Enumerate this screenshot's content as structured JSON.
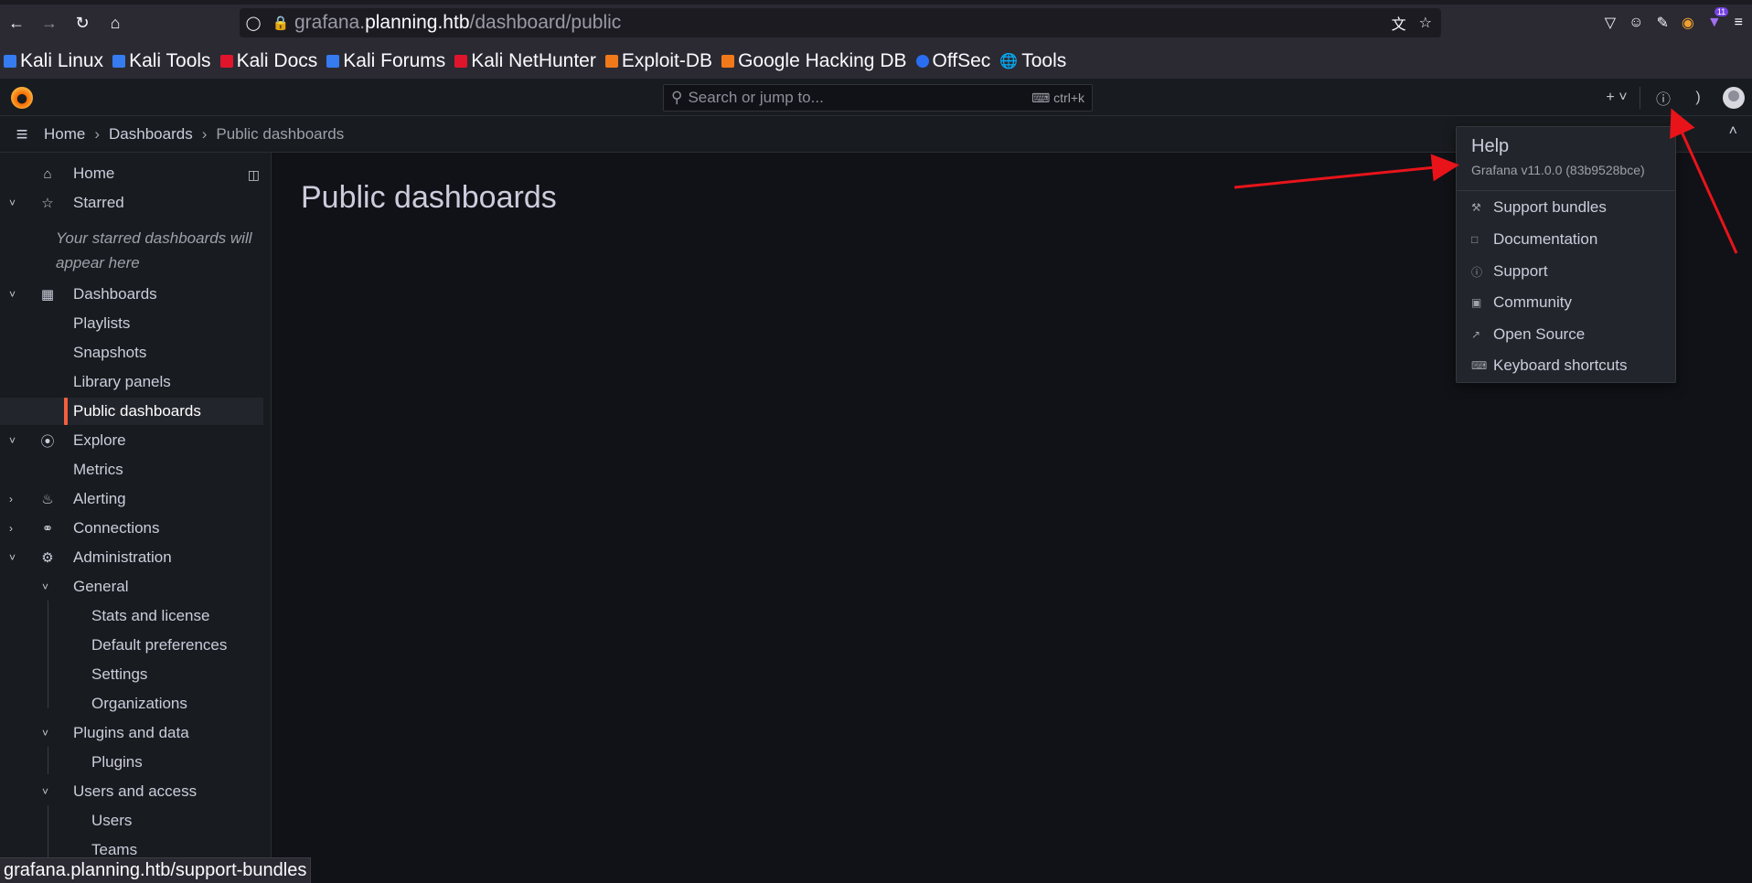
{
  "browser": {
    "url_host_prefix": "grafana.",
    "url_host_main": "planning.htb",
    "url_path": "/dashboard/public",
    "nav_icons": [
      "back-icon",
      "forward-icon",
      "reload-icon",
      "home-icon"
    ],
    "bookmarks": [
      {
        "label": "Kali Linux",
        "color": "#367bf0"
      },
      {
        "label": "Kali Tools",
        "color": "#367bf0"
      },
      {
        "label": "Kali Docs",
        "color": "#e0152b"
      },
      {
        "label": "Kali Forums",
        "color": "#367bf0"
      },
      {
        "label": "Kali NetHunter",
        "color": "#e0152b"
      },
      {
        "label": "Exploit-DB",
        "color": "#f07a1a"
      },
      {
        "label": "Google Hacking DB",
        "color": "#f07a1a"
      },
      {
        "label": "OffSec",
        "color": "#2a6df0"
      },
      {
        "label": "Tools",
        "color": "#fbfbfe"
      }
    ],
    "extension_badge": "11",
    "status_url": "grafana.planning.htb/support-bundles"
  },
  "grafana": {
    "search_placeholder": "Search or jump to...",
    "search_shortcut": "ctrl+k",
    "breadcrumb": [
      "Home",
      "Dashboards",
      "Public dashboards"
    ],
    "sidebar": {
      "home": "Home",
      "starred": "Starred",
      "starred_note": "Your starred dashboards will appear here",
      "dashboards": "Dashboards",
      "playlists": "Playlists",
      "snapshots": "Snapshots",
      "library_panels": "Library panels",
      "public_dashboards": "Public dashboards",
      "explore": "Explore",
      "metrics": "Metrics",
      "alerting": "Alerting",
      "connections": "Connections",
      "administration": "Administration",
      "general": "General",
      "stats_license": "Stats and license",
      "default_prefs": "Default preferences",
      "settings": "Settings",
      "organizations": "Organizations",
      "plugins_data": "Plugins and data",
      "plugins": "Plugins",
      "users_access": "Users and access",
      "users": "Users",
      "teams": "Teams"
    },
    "page_title": "Public dashboards",
    "help_menu": {
      "title": "Help",
      "version": "Grafana v11.0.0 (83b9528bce)",
      "items": [
        "Support bundles",
        "Documentation",
        "Support",
        "Community",
        "Open Source",
        "Keyboard shortcuts"
      ]
    },
    "accent_color": "#f55f3e"
  },
  "annotation_arrow_color": "#e8141a"
}
